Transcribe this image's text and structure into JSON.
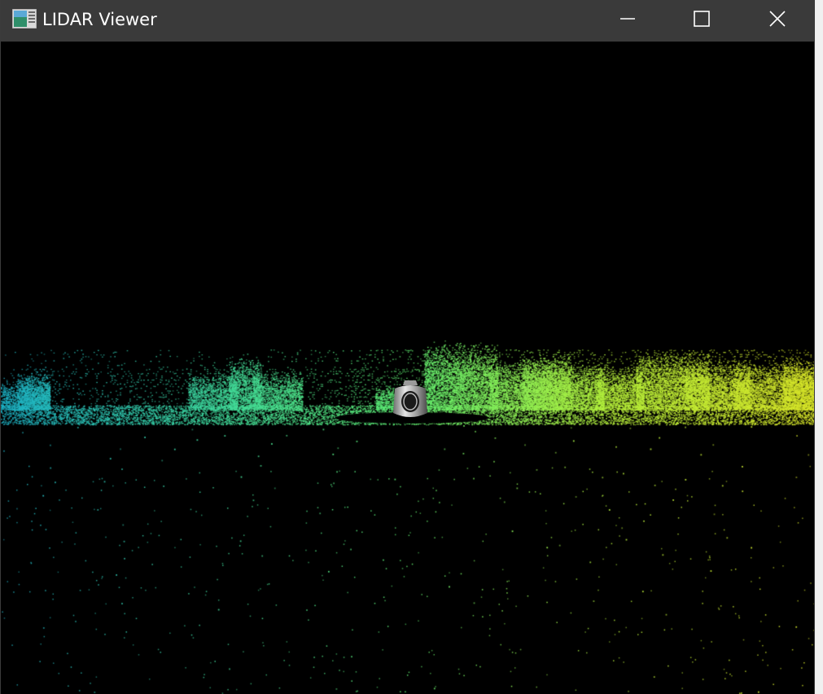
{
  "window": {
    "title": "LIDAR Viewer",
    "icon": "lidar-viewer-app-icon",
    "controls": {
      "minimize": "minimize-icon",
      "maximize": "maximize-icon",
      "close": "close-icon"
    }
  },
  "viewport": {
    "background": "#000000",
    "colormap": [
      "#1fb3c7",
      "#3fd9a0",
      "#62f274",
      "#b7f03c",
      "#d9e62a"
    ],
    "sensor_icon": "lidar-sensor-icon"
  },
  "colors": {
    "titlebar": "#3a3a3a",
    "title_text": "#ffffff"
  }
}
